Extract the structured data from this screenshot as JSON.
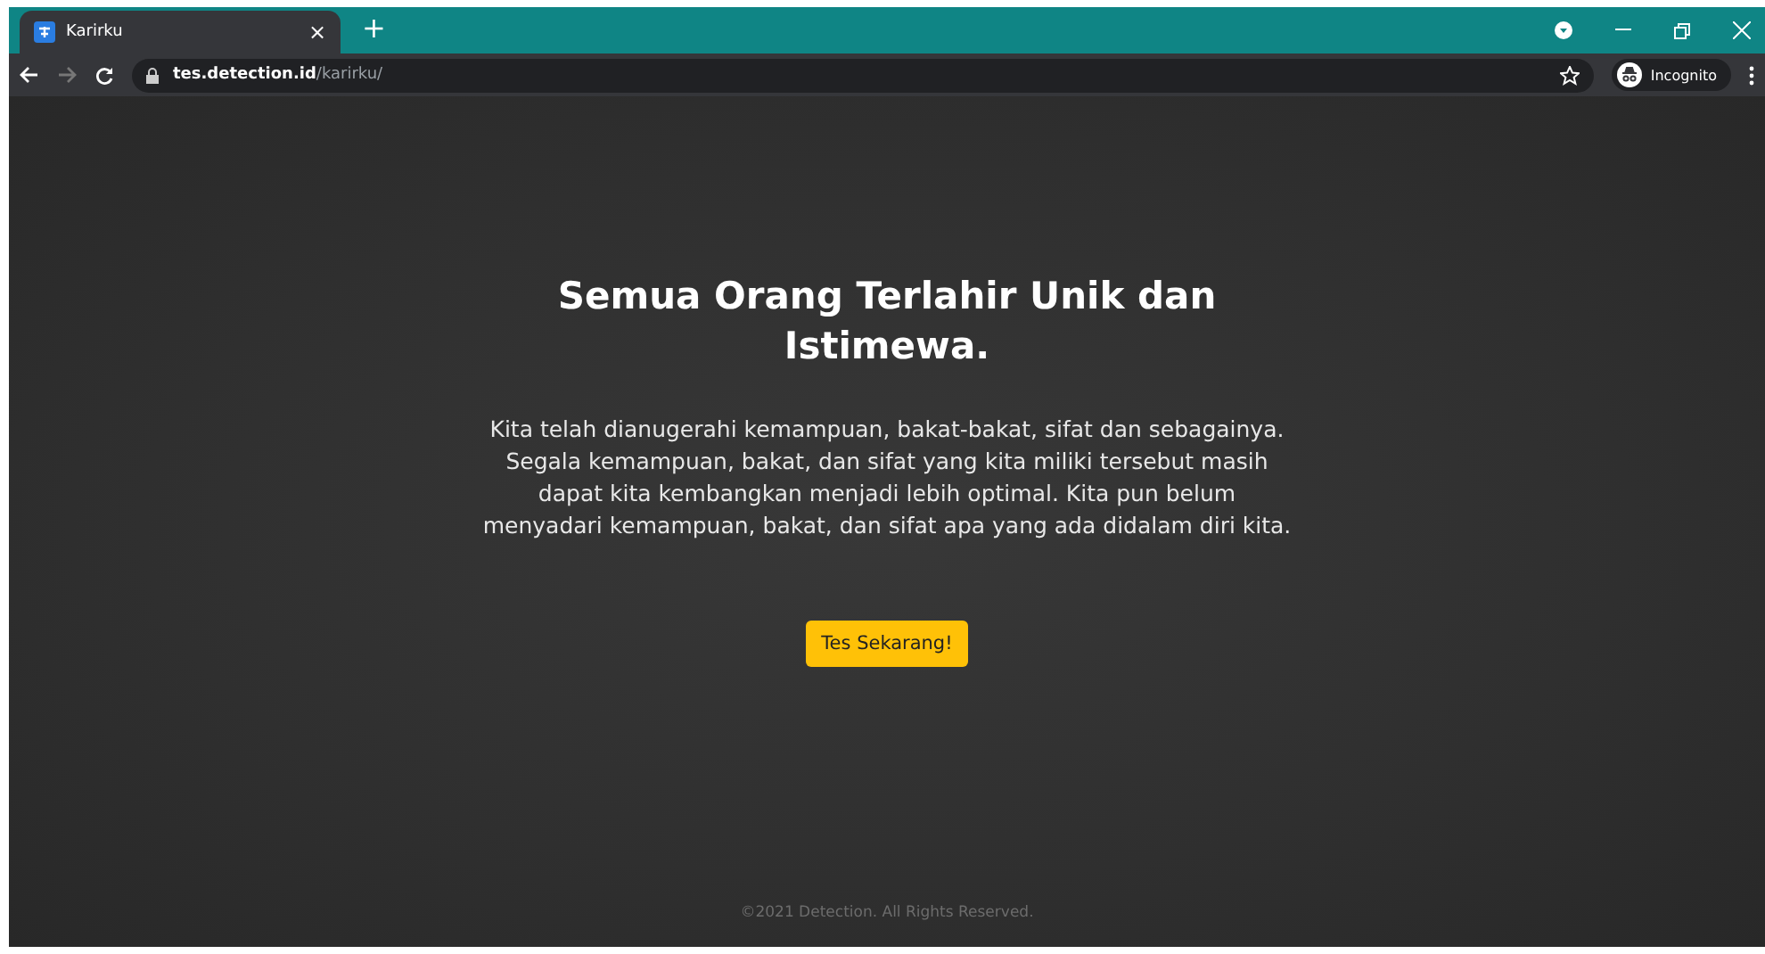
{
  "browser": {
    "tab": {
      "title": "Karirku",
      "close": "×"
    },
    "new_tab": "+",
    "url": {
      "host": "tes.detection.id",
      "path": "/karirku/"
    },
    "profile": "Incognito"
  },
  "hero": {
    "title": "Semua Orang Terlahir Unik dan Istimewa.",
    "text": "Kita telah dianugerahi kemampuan, bakat-bakat, sifat dan sebagainya. Segala kemampuan, bakat, dan sifat yang kita miliki tersebut masih dapat kita kembangkan menjadi lebih optimal. Kita pun belum menyadari kemampuan, bakat, dan sifat apa yang ada didalam diri kita.",
    "button": "Tes Sekarang!"
  },
  "footer": "©2021 Detection. All Rights Reserved."
}
